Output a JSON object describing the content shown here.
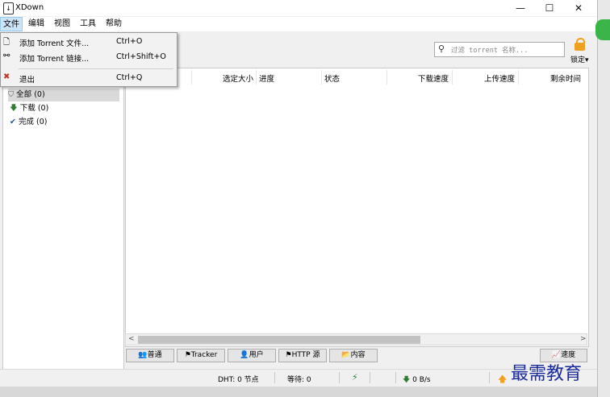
{
  "window": {
    "title": "XDown",
    "minimize": "—",
    "maximize": "☐",
    "close": "✕"
  },
  "menubar": {
    "items": [
      "文件",
      "编辑",
      "视图",
      "工具",
      "帮助"
    ]
  },
  "file_menu": {
    "items": [
      {
        "icon": "🗋",
        "label": "添加 Torrent 文件...",
        "shortcut": "Ctrl+O"
      },
      {
        "icon": "⚯",
        "label": "添加 Torrent 链接...",
        "shortcut": "Ctrl+Shift+O"
      },
      {
        "icon": "✖",
        "label": "退出",
        "shortcut": "Ctrl+Q"
      }
    ]
  },
  "search": {
    "placeholder": "过滤 torrent 名称..."
  },
  "lock": {
    "label": "锁定"
  },
  "sidebar": {
    "items": [
      {
        "icon": "filter",
        "glyph": "⛉",
        "label": "全部 (0)"
      },
      {
        "icon": "download-arrow",
        "glyph": "🡇",
        "label": "下载 (0)"
      },
      {
        "icon": "checkmark",
        "glyph": "✔",
        "label": "完成 (0)"
      }
    ]
  },
  "table": {
    "columns": [
      "选定大小",
      "进度",
      "状态",
      "下载速度",
      "上传速度",
      "剩余时间"
    ]
  },
  "tabs": [
    {
      "icon": "👥",
      "label": "普通"
    },
    {
      "icon": "⚑",
      "label": "Tracker"
    },
    {
      "icon": "👤",
      "label": "用户"
    },
    {
      "icon": "⚑",
      "label": "HTTP 源"
    },
    {
      "icon": "📂",
      "label": "内容"
    }
  ],
  "speed_button": {
    "icon": "📈",
    "label": "速度"
  },
  "status": {
    "dht": "DHT: 0 节点",
    "waiting": "等待: 0",
    "download": "0 B/s"
  },
  "colors": {
    "accent": "#cce4f7",
    "lock": "#f0a020",
    "green": "#2e7d32",
    "exit_red": "#c0392b"
  },
  "watermark": "最需教育"
}
